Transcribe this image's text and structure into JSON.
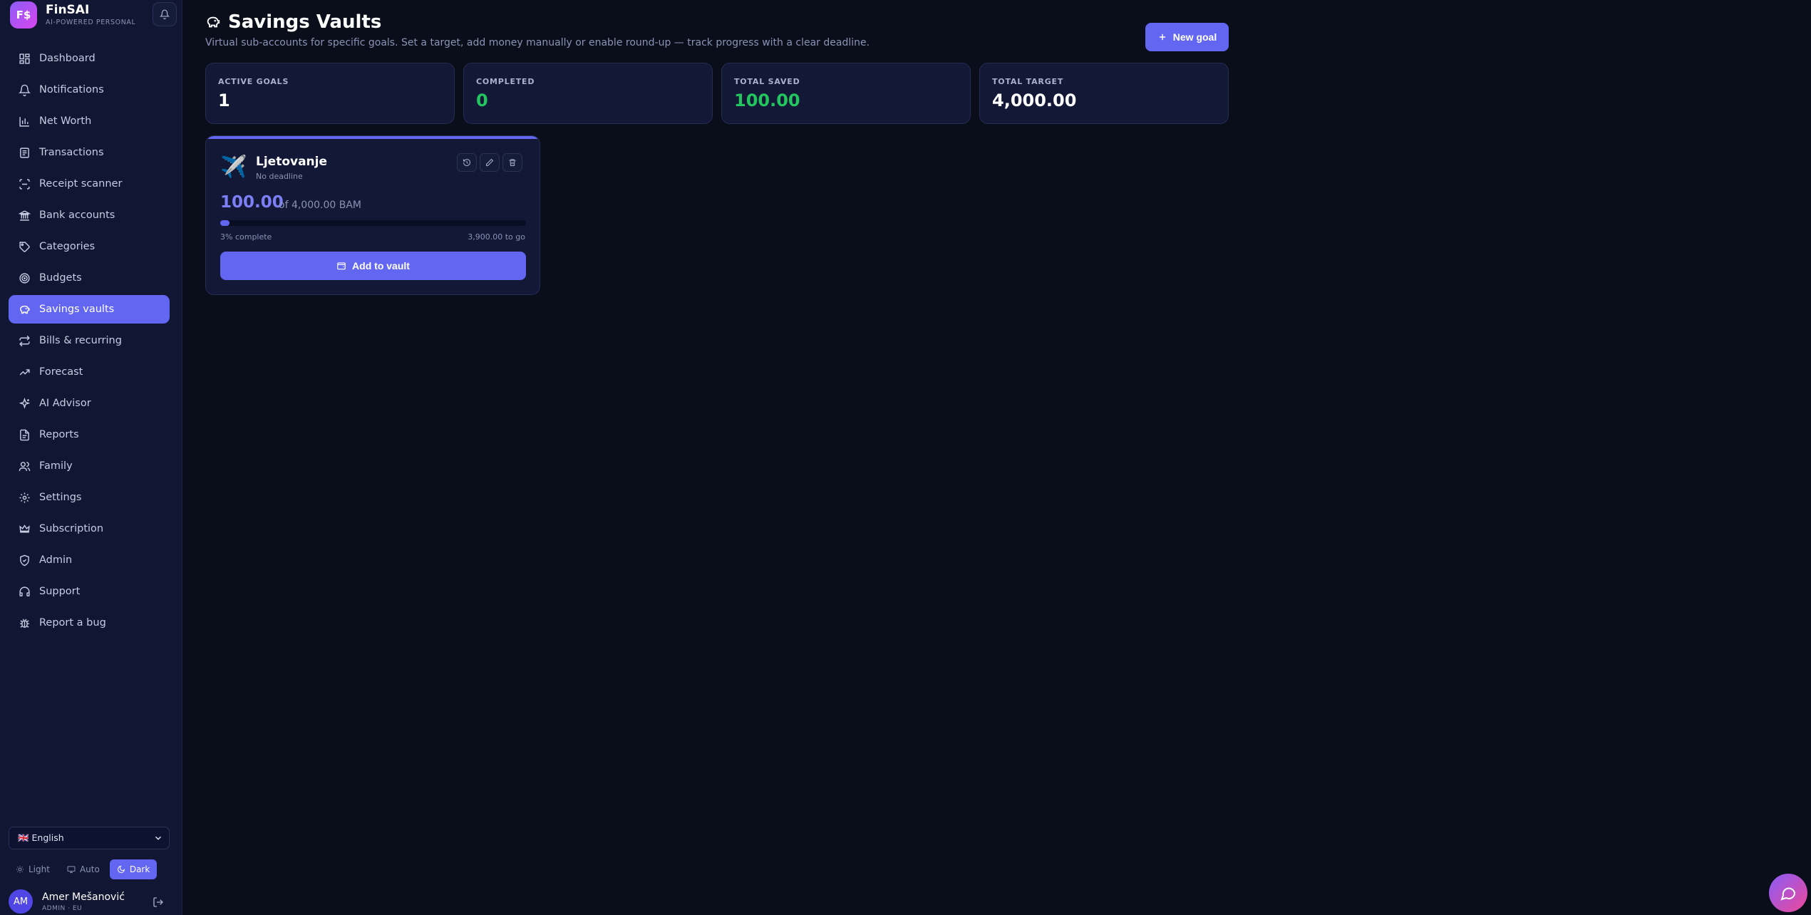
{
  "brand": {
    "logo_text": "F$",
    "name": "FinSAI",
    "tagline": "AI-POWERED PERSONAL FINANCE"
  },
  "nav": [
    {
      "label": "Dashboard",
      "icon": "dashboard-icon"
    },
    {
      "label": "Notifications",
      "icon": "bell-icon"
    },
    {
      "label": "Net Worth",
      "icon": "bar-chart-icon"
    },
    {
      "label": "Transactions",
      "icon": "receipt-icon"
    },
    {
      "label": "Receipt scanner",
      "icon": "scan-icon"
    },
    {
      "label": "Bank accounts",
      "icon": "bank-icon"
    },
    {
      "label": "Categories",
      "icon": "tag-icon"
    },
    {
      "label": "Budgets",
      "icon": "target-icon"
    },
    {
      "label": "Savings vaults",
      "icon": "piggy-bank-icon",
      "active": true
    },
    {
      "label": "Bills & recurring",
      "icon": "repeat-icon"
    },
    {
      "label": "Forecast",
      "icon": "trending-up-icon"
    },
    {
      "label": "AI Advisor",
      "icon": "sparkles-icon"
    },
    {
      "label": "Reports",
      "icon": "file-icon"
    },
    {
      "label": "Family",
      "icon": "users-icon"
    },
    {
      "label": "Settings",
      "icon": "gear-icon"
    },
    {
      "label": "Subscription",
      "icon": "crown-icon"
    },
    {
      "label": "Admin",
      "icon": "shield-icon"
    },
    {
      "label": "Support",
      "icon": "headset-icon"
    },
    {
      "label": "Report a bug",
      "icon": "bug-icon"
    }
  ],
  "language": {
    "selected": "🇬🇧 English"
  },
  "theme": {
    "light": "Light",
    "auto": "Auto",
    "dark": "Dark",
    "active": "dark"
  },
  "user": {
    "initials": "AM",
    "name": "Amer Mešanović",
    "role": "ADMIN · EU"
  },
  "page": {
    "title": "Savings Vaults",
    "subtitle": "Virtual sub-accounts for specific goals. Set a target, add money manually or enable round-up — track progress with a clear deadline.",
    "new_goal_label": "New goal"
  },
  "stats": [
    {
      "label": "ACTIVE GOALS",
      "value": "1",
      "color": "#ffffff"
    },
    {
      "label": "COMPLETED",
      "value": "0",
      "color": "#22c55e"
    },
    {
      "label": "TOTAL SAVED",
      "value": "100.00",
      "color": "#22c55e"
    },
    {
      "label": "TOTAL TARGET",
      "value": "4,000.00",
      "color": "#ffffff"
    }
  ],
  "vault": {
    "emoji": "✈️",
    "name": "Ljetovanje",
    "deadline": "No deadline",
    "amount": "100.00",
    "of_text": "of 4,000.00 BAM",
    "progress": 0.03,
    "percent_text": "3% complete",
    "to_go_text": "3,900.00 to go",
    "add_label": "Add to vault"
  },
  "colors": {
    "accent": "#6366f1",
    "positive": "#22c55e",
    "background": "#0a0d1a",
    "sidebar": "#111733"
  }
}
